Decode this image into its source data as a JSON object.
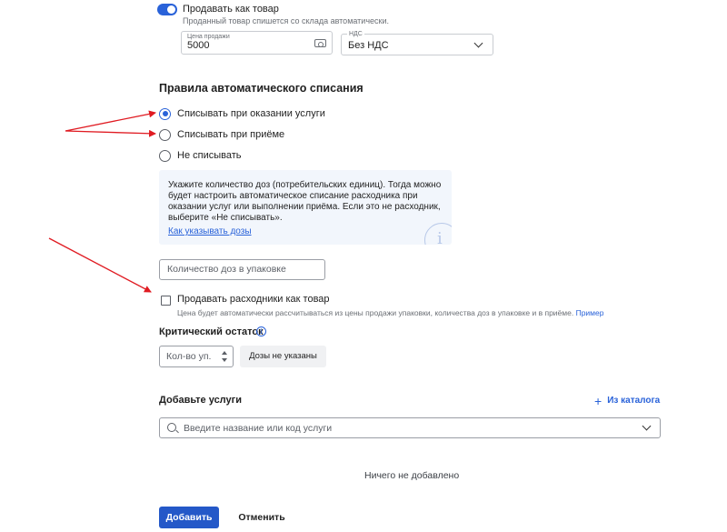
{
  "sell_as_product": {
    "label": "Продавать как товар",
    "hint": "Проданный товар спишется со склада автоматически.",
    "enabled": true
  },
  "price": {
    "label": "Цена продажи",
    "value": "5000",
    "icon": "cash-icon"
  },
  "vat": {
    "label": "НДС",
    "value": "Без НДС"
  },
  "writeoff": {
    "title": "Правила автоматического списания",
    "options": [
      {
        "label": "Списывать при оказании услуги",
        "checked": true
      },
      {
        "label": "Списывать при приёме",
        "checked": false
      },
      {
        "label": "Не списывать",
        "checked": false
      }
    ]
  },
  "info": {
    "text": "Укажите количество доз (потребительских единиц). Тогда можно будет настроить автоматическое списание расходника при оказании услуг или выполнении приёма. Если это не расходник, выберите «Не списывать».",
    "link": "Как указывать дозы",
    "icon": "info-icon"
  },
  "doses": {
    "placeholder": "Количество доз в упаковке"
  },
  "sell_consumables": {
    "label": "Продавать расходники как товар",
    "hint": "Цена будет автоматически рассчитываться из цены продажи упаковки, количества доз в упаковке и в приёме.",
    "hint_link": "Пример",
    "checked": false
  },
  "critical": {
    "title": "Критический остаток",
    "qty_placeholder": "Кол-во уп.",
    "doses_badge": "Дозы не указаны"
  },
  "services": {
    "title": "Добавьте услуги",
    "catalog_link": "Из каталога",
    "search_placeholder": "Введите название или код услуги",
    "empty": "Ничего не добавлено"
  },
  "actions": {
    "add": "Добавить",
    "cancel": "Отменить"
  },
  "colors": {
    "accent": "#2962d9",
    "annotation_arrow": "#e01b22",
    "info_bg": "#f2f6fc"
  }
}
